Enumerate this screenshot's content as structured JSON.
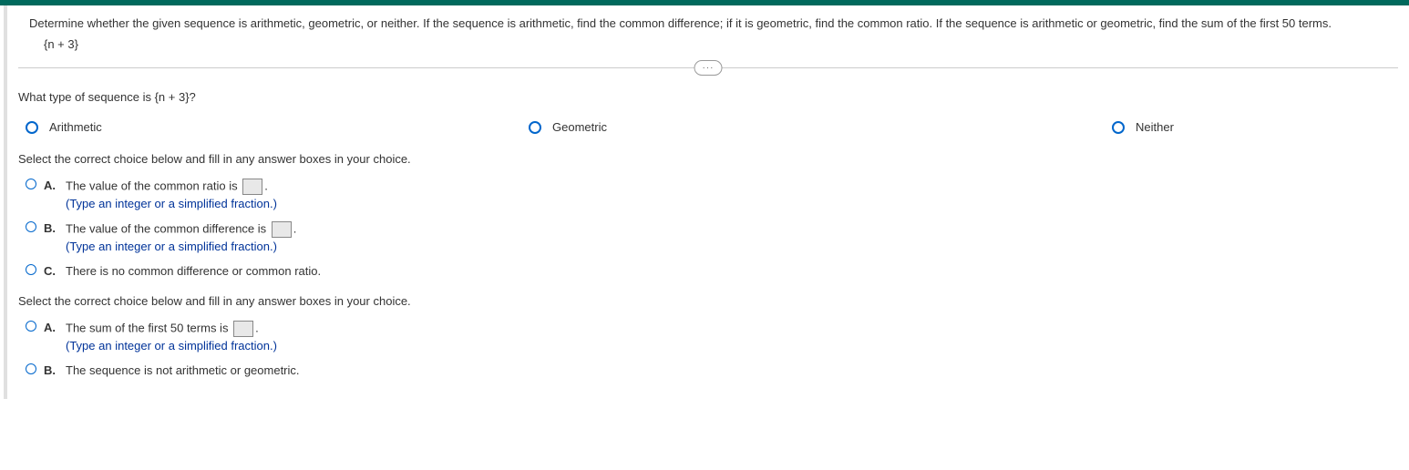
{
  "question": {
    "prompt": "Determine whether the given sequence is arithmetic, geometric, or neither. If the sequence is arithmetic, find the common difference; if it is geometric, find the common ratio. If the sequence is arithmetic or geometric, find the sum of the first 50 terms.",
    "sequence": "{n + 3}"
  },
  "expander": "···",
  "part1": {
    "question": "What type of sequence is {n + 3}?",
    "options": {
      "arithmetic": "Arithmetic",
      "geometric": "Geometric",
      "neither": "Neither"
    }
  },
  "part2": {
    "instruction": "Select the correct choice below and fill in any answer boxes in your choice.",
    "choices": {
      "a": {
        "label": "A.",
        "text_before": "The value of the common ratio is ",
        "text_after": ".",
        "hint": "(Type an integer or a simplified fraction.)"
      },
      "b": {
        "label": "B.",
        "text_before": "The value of the common difference is ",
        "text_after": ".",
        "hint": "(Type an integer or a simplified fraction.)"
      },
      "c": {
        "label": "C.",
        "text": "There is no common difference or common ratio."
      }
    }
  },
  "part3": {
    "instruction": "Select the correct choice below and fill in any answer boxes in your choice.",
    "choices": {
      "a": {
        "label": "A.",
        "text_before": "The sum of the first 50 terms is ",
        "text_after": ".",
        "hint": "(Type an integer or a simplified fraction.)"
      },
      "b": {
        "label": "B.",
        "text": "The sequence is not arithmetic or geometric."
      }
    }
  }
}
